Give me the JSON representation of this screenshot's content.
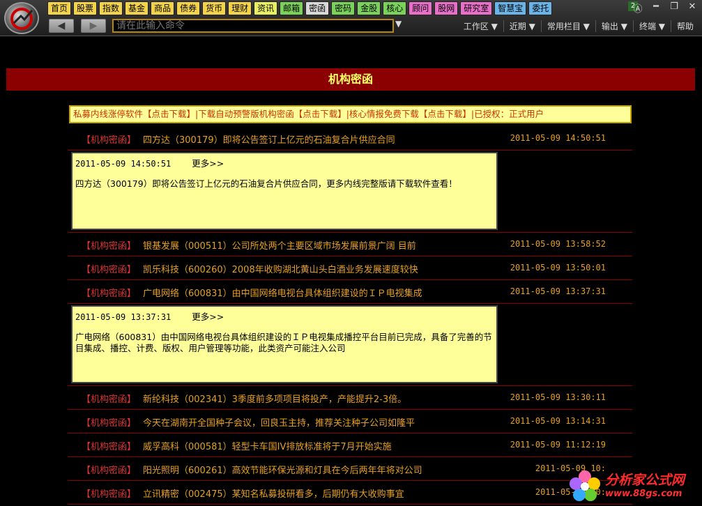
{
  "toolbar": {
    "nav": [
      {
        "label": "首页",
        "color": "#f2d34a"
      },
      {
        "label": "股票",
        "color": "#f2d34a"
      },
      {
        "label": "指数",
        "color": "#f2d34a"
      },
      {
        "label": "基金",
        "color": "#f2d34a"
      },
      {
        "label": "商品",
        "color": "#f2d34a"
      },
      {
        "label": "债券",
        "color": "#f2d34a"
      },
      {
        "label": "货币",
        "color": "#f2d34a"
      },
      {
        "label": "理财",
        "color": "#f2d34a"
      },
      {
        "label": "资讯",
        "color": "#e8f060"
      },
      {
        "label": "邮箱",
        "color": "#7ad25a"
      },
      {
        "label": "密函",
        "color": "#d8d8d8"
      },
      {
        "label": "密码",
        "color": "#7ad25a"
      },
      {
        "label": "金股",
        "color": "#7ad25a"
      },
      {
        "label": "核心",
        "color": "#7ad25a"
      },
      {
        "label": "顾问",
        "color": "#e870c8"
      },
      {
        "label": "股网",
        "color": "#e870c8"
      },
      {
        "label": "研究室",
        "color": "#e870c8"
      },
      {
        "label": "智慧宝",
        "color": "#6ab4e8"
      },
      {
        "label": "委托",
        "color": "#6ab4e8"
      }
    ],
    "back_icon": "arrow-left-icon",
    "forward_icon": "arrow-right-icon",
    "command_placeholder": "请在此输入命令",
    "badge": "2",
    "menus": [
      "工作区 ▼",
      "近期 ▼",
      "常用栏目 ▼",
      "输出 ▼",
      "终端 ▼",
      "帮助"
    ]
  },
  "page": {
    "title": "机构密函",
    "promo": "私募内线涨停软件【点击下载】|下载自动预警版机构密函【点击下载】|核心情报免费下载【点击下载】|已授权：正式用户"
  },
  "news": [
    {
      "tag": "【机构密函】",
      "text": "四方达（300179）即将公告签订上亿元的石油复合片供应合同",
      "time": "2011-05-09 14:50:51",
      "detail": {
        "time": "2011-05-09 14:50:51",
        "more": "更多>>",
        "body": " 四方达（300179）即将公告签订上亿元的石油复合片供应合同，更多内线完整版请下载软件查看！"
      }
    },
    {
      "tag": "【机构密函】",
      "text": "银基发展（000511）公司所处两个主要区域市场发展前景广阔 目前",
      "time": "2011-05-09 13:58:52"
    },
    {
      "tag": "【机构密函】",
      "text": "凯乐科技（600260）2008年收购湖北黄山头白酒业务发展速度较快",
      "time": "2011-05-09 13:50:01"
    },
    {
      "tag": "【机构密函】",
      "text": "广电网络（600831）由中国网络电视台具体组织建设的ＩＰ电视集成",
      "time": "2011-05-09 13:37:31",
      "detail": {
        "time": "2011-05-09 13:37:31",
        "more": "更多>>",
        "body": "广电网络（600831）由中国网络电视台具体组织建设的ＩＰ电视集成播控平台目前已完成，具备了完善的节目集成、播控、计费、版权、用户管理等功能，此类资产可能注入公司"
      }
    },
    {
      "tag": "【机构密函】",
      "text": "新纶科技（002341）3季度前多项项目将投产，产能提升2-3倍。",
      "time": "2011-05-09 13:30:11"
    },
    {
      "tag": "【机构密函】",
      "text": "今天在湖南开全国种子会议，回良玉主持，推荐关注种子公司如隆平",
      "time": "2011-05-09 13:14:31"
    },
    {
      "tag": "【机构密函】",
      "text": "威孚高科（000581）轻型卡车国IV排放标准将于7月开始实施",
      "time": "2011-05-09 11:12:19"
    },
    {
      "tag": "【机构密函】",
      "text": "阳光照明（600261）高效节能环保光源和灯具在今后两年年将对公司",
      "time": "2011-05-09 10:"
    },
    {
      "tag": "【机构密函】",
      "text": "立讯精密（002475）某知名私募投研看多，后期仍有大收购事宜",
      "time": "2011-05-09 10:"
    }
  ],
  "watermark": {
    "title": "分析家公式网",
    "url": "www.88gs.com"
  }
}
